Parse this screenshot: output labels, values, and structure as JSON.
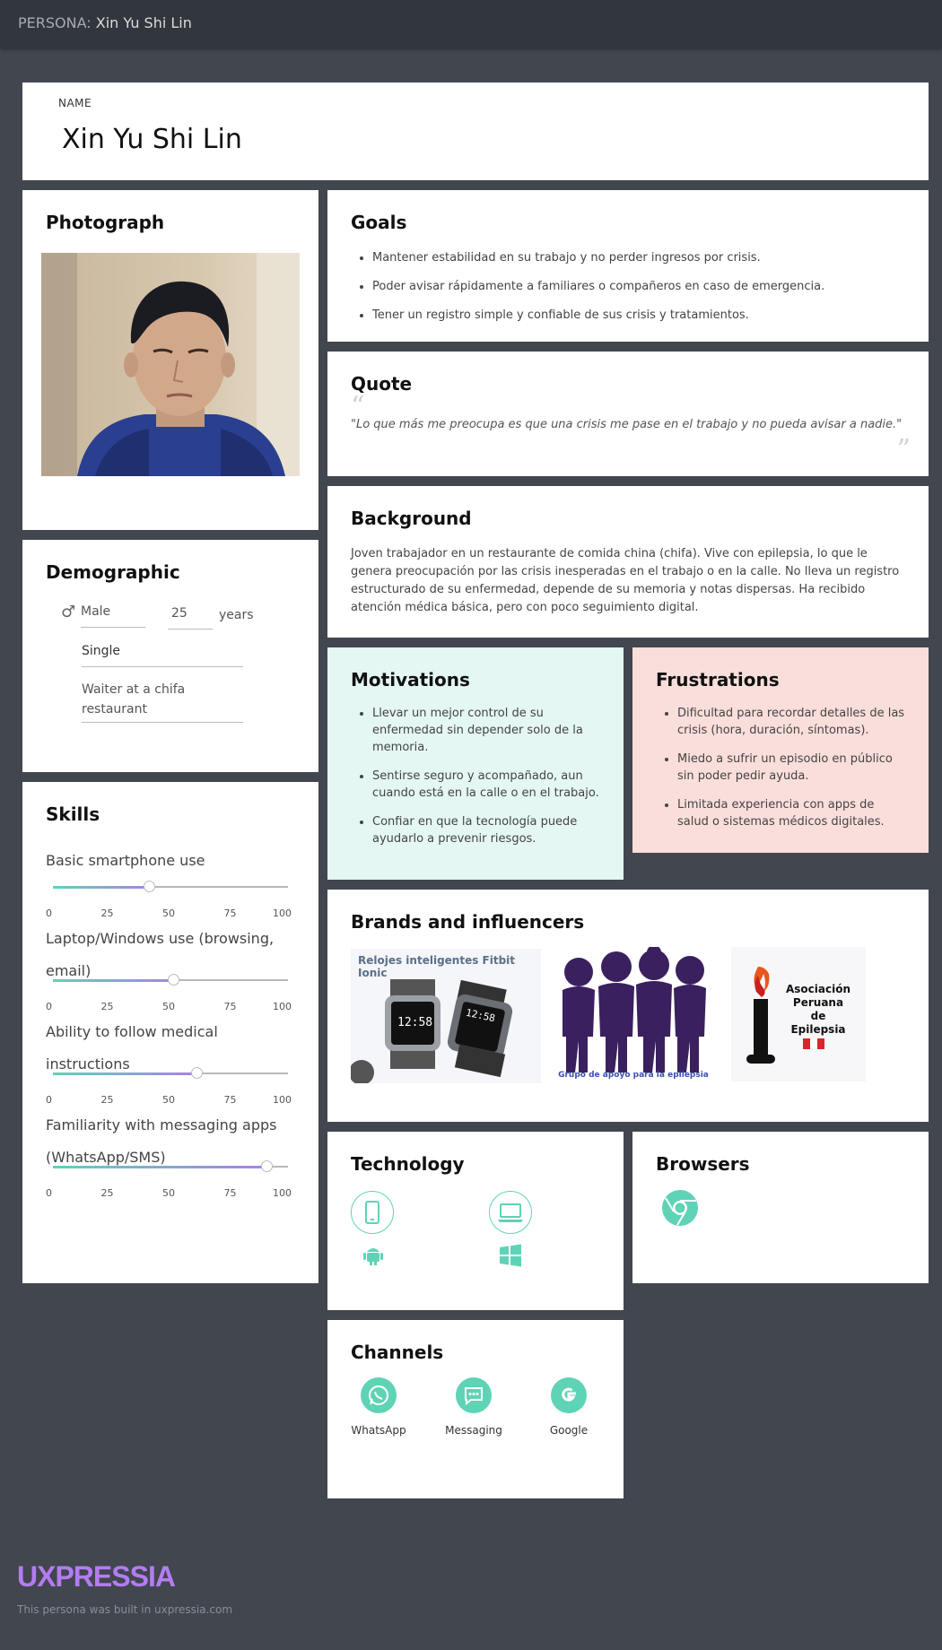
{
  "header": {
    "prefix": "PERSONA:",
    "name": "Xin Yu Shi Lin"
  },
  "name_card": {
    "label": "NAME",
    "value": "Xin Yu Shi Lin"
  },
  "photograph": {
    "title": "Photograph"
  },
  "goals": {
    "title": "Goals",
    "items": [
      "Mantener estabilidad en su trabajo y no perder ingresos por crisis.",
      "Poder avisar rápidamente a familiares o compañeros en caso de emergencia.",
      "Tener un registro simple y confiable de sus crisis y tratamientos."
    ]
  },
  "quote": {
    "title": "Quote",
    "text": "\"Lo que más me preocupa es que una crisis me pase en el trabajo y no pueda avisar a nadie.\""
  },
  "background": {
    "title": "Background",
    "text": "Joven trabajador en un restaurante de comida china (chifa). Vive con epilepsia, lo que le genera preocupación por las crisis inesperadas en el trabajo o en la calle. No lleva un registro estructurado de su enfermedad, depende de su memoria y notas dispersas. Ha recibido atención médica básica, pero con poco seguimiento digital."
  },
  "demographic": {
    "title": "Demographic",
    "gender_icon": "male-symbol-icon",
    "gender": "Male",
    "age": "25",
    "age_unit": "years",
    "status": "Single",
    "occupation": "Waiter at a chifa restaurant"
  },
  "motivations": {
    "title": "Motivations",
    "items": [
      "Llevar un mejor control de su enfermedad sin depender solo de la memoria.",
      "Sentirse seguro y acompañado, aun cuando está en la calle o en el trabajo.",
      "Confiar en que la tecnología puede ayudarlo a prevenir riesgos."
    ]
  },
  "frustrations": {
    "title": "Frustrations",
    "items": [
      "Dificultad para recordar detalles de las crisis (hora, duración, síntomas).",
      "Miedo a sufrir un episodio en público sin poder pedir ayuda.",
      "Limitada experiencia con apps de salud o sistemas médicos digitales."
    ]
  },
  "skills": {
    "title": "Skills",
    "ticks": [
      "0",
      "25",
      "50",
      "75",
      "100"
    ],
    "items": [
      {
        "label": "Basic smartphone use",
        "value": 41
      },
      {
        "label": "Laptop/Windows use (browsing, email)",
        "value": 51
      },
      {
        "label": "Ability to follow medical instructions",
        "value": 61
      },
      {
        "label": "Familiarity with messaging apps (WhatsApp/SMS)",
        "value": 91
      }
    ]
  },
  "brands": {
    "title": "Brands and influencers",
    "fitbit_caption": "Relojes inteligentes Fitbit Ionic",
    "watch_time_1": "12:58",
    "watch_time_2": "12:58",
    "group_caption": "Grupo de apoyo para la epilepsia",
    "association_line1": "Asociación",
    "association_line2": "Peruana",
    "association_line3": "de",
    "association_line4": "Epilepsia"
  },
  "technology": {
    "title": "Technology",
    "icons": [
      "smartphone-icon",
      "laptop-icon",
      "android-icon",
      "windows-icon"
    ]
  },
  "browsers": {
    "title": "Browsers",
    "icons": [
      "chrome-icon"
    ]
  },
  "channels": {
    "title": "Channels",
    "items": [
      {
        "label": "WhatsApp",
        "icon": "whatsapp-icon"
      },
      {
        "label": "Messaging",
        "icon": "messaging-icon"
      },
      {
        "label": "Google",
        "icon": "google-icon"
      }
    ]
  },
  "footer": {
    "logo": "UXPRESSIA",
    "note": "This persona was built in uxpressia.com"
  },
  "colors": {
    "accent": "#5fd3b6",
    "purple": "#a782e8",
    "motivations_bg": "#e4f7f2",
    "frustrations_bg": "#fadedb",
    "page_bg": "#41464f"
  }
}
